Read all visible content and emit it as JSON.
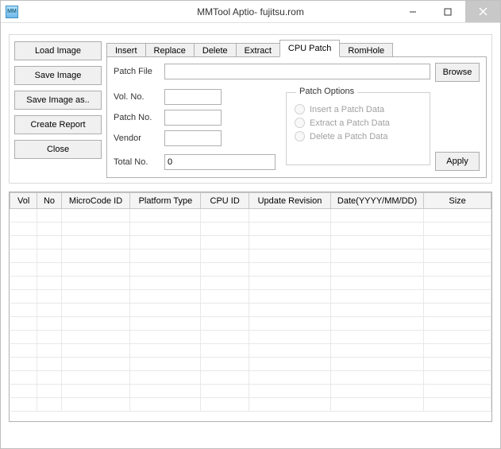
{
  "window": {
    "title": "MMTool Aptio- fujitsu.rom",
    "icon_text": "MM"
  },
  "buttons": {
    "load": "Load Image",
    "save": "Save Image",
    "saveas": "Save Image as..",
    "report": "Create Report",
    "close": "Close",
    "browse": "Browse",
    "apply": "Apply"
  },
  "tabs": {
    "insert": "Insert",
    "replace": "Replace",
    "delete": "Delete",
    "extract": "Extract",
    "cpupatch": "CPU Patch",
    "romhole": "RomHole"
  },
  "labels": {
    "patchfile": "Patch File",
    "volno": "Vol. No.",
    "patchno": "Patch No.",
    "vendor": "Vendor",
    "totalno": "Total No.",
    "patchoptions": "Patch Options",
    "radio_insert": "Insert a Patch Data",
    "radio_extract": "Extract a Patch Data",
    "radio_delete": "Delete a Patch Data"
  },
  "values": {
    "patchfile": "",
    "volno": "",
    "patchno": "",
    "vendor": "",
    "totalno": "0"
  },
  "columns": {
    "vol": "Vol",
    "no": "No",
    "microcode": "MicroCode ID",
    "platform": "Platform Type",
    "cpuid": "CPU ID",
    "revision": "Update Revision",
    "date": "Date(YYYY/MM/DD)",
    "size": "Size"
  }
}
